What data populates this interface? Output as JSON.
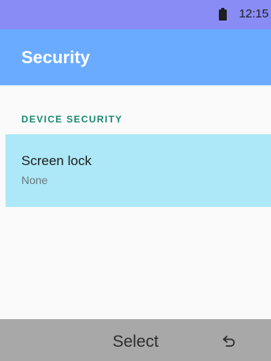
{
  "status_bar": {
    "time": "12:15",
    "battery_icon": "battery-icon"
  },
  "app_bar": {
    "title": "Security"
  },
  "section": {
    "header": "DEVICE SECURITY",
    "items": [
      {
        "title": "Screen lock",
        "subtitle": "None"
      }
    ]
  },
  "softkeys": {
    "center_label": "Select",
    "right_icon": "back-icon"
  },
  "colors": {
    "status_bar": "#8a8cf5",
    "app_bar": "#6aabff",
    "section_header": "#1b8a72",
    "selected_item": "#ade8f8",
    "softkey_bar": "#a8a8a8"
  }
}
